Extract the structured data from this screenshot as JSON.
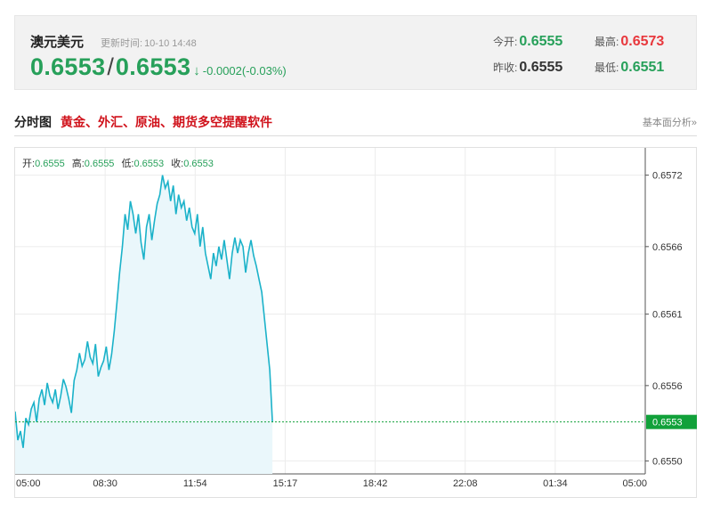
{
  "quote": {
    "name": "澳元美元",
    "update_label": "更新时间:",
    "update_time": "10-10 14:48",
    "bid": "0.6553",
    "separator": "/",
    "ask": "0.6553",
    "arrow": "↓",
    "change": "-0.0002(-0.03%)",
    "open_label": "今开:",
    "open": "0.6555",
    "prev_close_label": "昨收:",
    "prev_close": "0.6555",
    "high_label": "最高:",
    "high": "0.6573",
    "low_label": "最低:",
    "low": "0.6551"
  },
  "section": {
    "title": "分时图",
    "promo_link": "黄金、外汇、原油、期货多空提醒软件",
    "basic_link": "基本面分析»"
  },
  "ohlc": {
    "open_label": "开:",
    "open": "0.6555",
    "high_label": "高:",
    "high": "0.6555",
    "low_label": "低:",
    "low": "0.6553",
    "close_label": "收:",
    "close": "0.6553"
  },
  "colors": {
    "up_green": "#27a05a",
    "down_red": "#e8383d",
    "line": "#1bb2c9",
    "fill": "#eaf7fb",
    "last_price_tag": "#11a13a"
  },
  "chart_data": {
    "type": "area",
    "x_ticks": [
      "05:00",
      "08:30",
      "11:54",
      "15:17",
      "18:42",
      "22:08",
      "01:34",
      "05:00"
    ],
    "y_ticks": [
      "0.6550",
      "0.6556",
      "0.6561",
      "0.6566",
      "0.6572"
    ],
    "y_tick_values": [
      0.655,
      0.65558,
      0.65613,
      0.65665,
      0.6572
    ],
    "ylim": [
      0.6549,
      0.65741
    ],
    "last_price": 0.6553,
    "last_price_label": "0.6553",
    "grid": true,
    "series": [
      {
        "x_start": "05:00",
        "x_end": "14:48",
        "values": [
          0.65538,
          0.65516,
          0.65523,
          0.6551,
          0.65533,
          0.65528,
          0.6554,
          0.65545,
          0.6553,
          0.65548,
          0.65555,
          0.65543,
          0.6556,
          0.6555,
          0.65545,
          0.65555,
          0.6554,
          0.6555,
          0.65563,
          0.65557,
          0.65548,
          0.65537,
          0.65562,
          0.6557,
          0.65583,
          0.65573,
          0.65578,
          0.65592,
          0.6558,
          0.65575,
          0.6559,
          0.65565,
          0.65572,
          0.65577,
          0.65588,
          0.6557,
          0.65582,
          0.656,
          0.65622,
          0.65645,
          0.65665,
          0.6569,
          0.65678,
          0.657,
          0.6569,
          0.65675,
          0.6569,
          0.65668,
          0.65655,
          0.6568,
          0.6569,
          0.6567,
          0.65685,
          0.65698,
          0.65705,
          0.6572,
          0.6571,
          0.65715,
          0.657,
          0.65712,
          0.6569,
          0.65705,
          0.65695,
          0.657,
          0.65685,
          0.65695,
          0.6568,
          0.65675,
          0.6569,
          0.65665,
          0.6568,
          0.6566,
          0.6565,
          0.6564,
          0.6566,
          0.6565,
          0.65665,
          0.65655,
          0.6567,
          0.65655,
          0.6564,
          0.6566,
          0.65672,
          0.6566,
          0.6567,
          0.65665,
          0.65645,
          0.6566,
          0.6567,
          0.65658,
          0.6565,
          0.6564,
          0.6563,
          0.6561,
          0.6559,
          0.6557,
          0.6553
        ]
      }
    ]
  }
}
